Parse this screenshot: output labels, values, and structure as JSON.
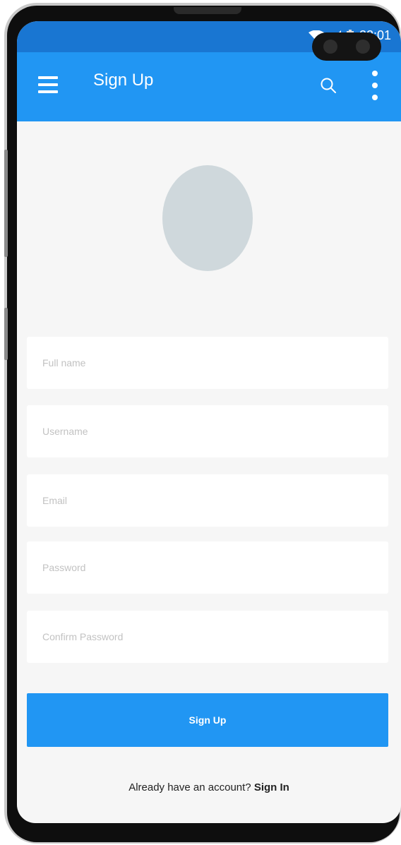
{
  "status_bar": {
    "time": "22:01",
    "icons": [
      "wifi-icon",
      "signal-icon",
      "battery-icon"
    ],
    "color": "#1976d2"
  },
  "app_bar": {
    "title": "Sign Up",
    "color": "#2196f3",
    "icons": [
      "menu-icon",
      "search-icon",
      "more-vert-icon"
    ]
  },
  "avatar": {
    "icon": "profile-avatar-placeholder",
    "color": "#cfd8dc"
  },
  "form": {
    "full_name_placeholder": "Full name",
    "username_placeholder": "Username",
    "email_placeholder": "Email",
    "password_placeholder": "Password",
    "confirm_password_placeholder": "Confirm Password"
  },
  "submit": {
    "label": "Sign Up",
    "color": "#2196f3"
  },
  "footer": {
    "prompt": "Already have an account?",
    "link": "Sign In"
  }
}
